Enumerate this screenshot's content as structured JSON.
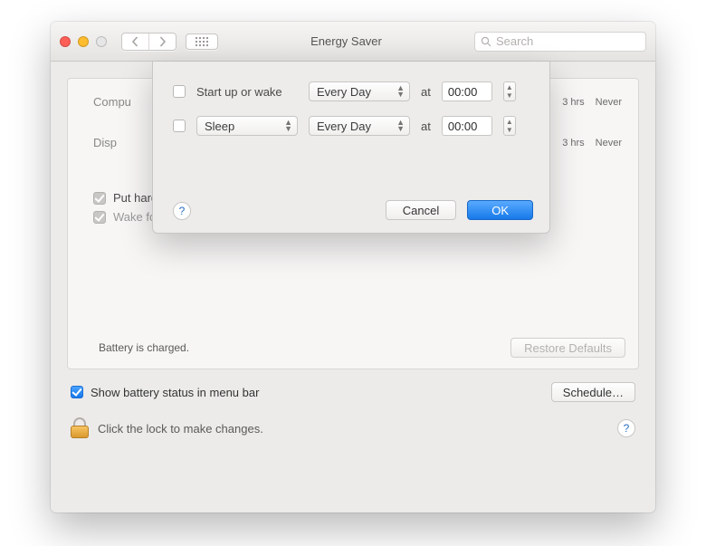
{
  "window": {
    "title": "Energy Saver",
    "search_placeholder": "Search"
  },
  "panel": {
    "computer_sleep_label": "Compu",
    "display_sleep_label": "Disp",
    "tick_3hrs": "3 hrs",
    "tick_never": "Never",
    "hd_sleep_label": "Put hard disks to sleep when possible",
    "wake_network_label": "Wake for network access",
    "battery_status": "Battery is charged.",
    "restore_label": "Restore Defaults"
  },
  "footer": {
    "show_battery_label": "Show battery status in menu bar",
    "schedule_label": "Schedule…",
    "lock_label": "Click the lock to make changes."
  },
  "modal": {
    "row1_label": "Start up or wake",
    "row1_freq": "Every Day",
    "row1_at": "at",
    "row1_time": "00:00",
    "row2_action": "Sleep",
    "row2_freq": "Every Day",
    "row2_at": "at",
    "row2_time": "00:00",
    "cancel": "Cancel",
    "ok": "OK"
  }
}
